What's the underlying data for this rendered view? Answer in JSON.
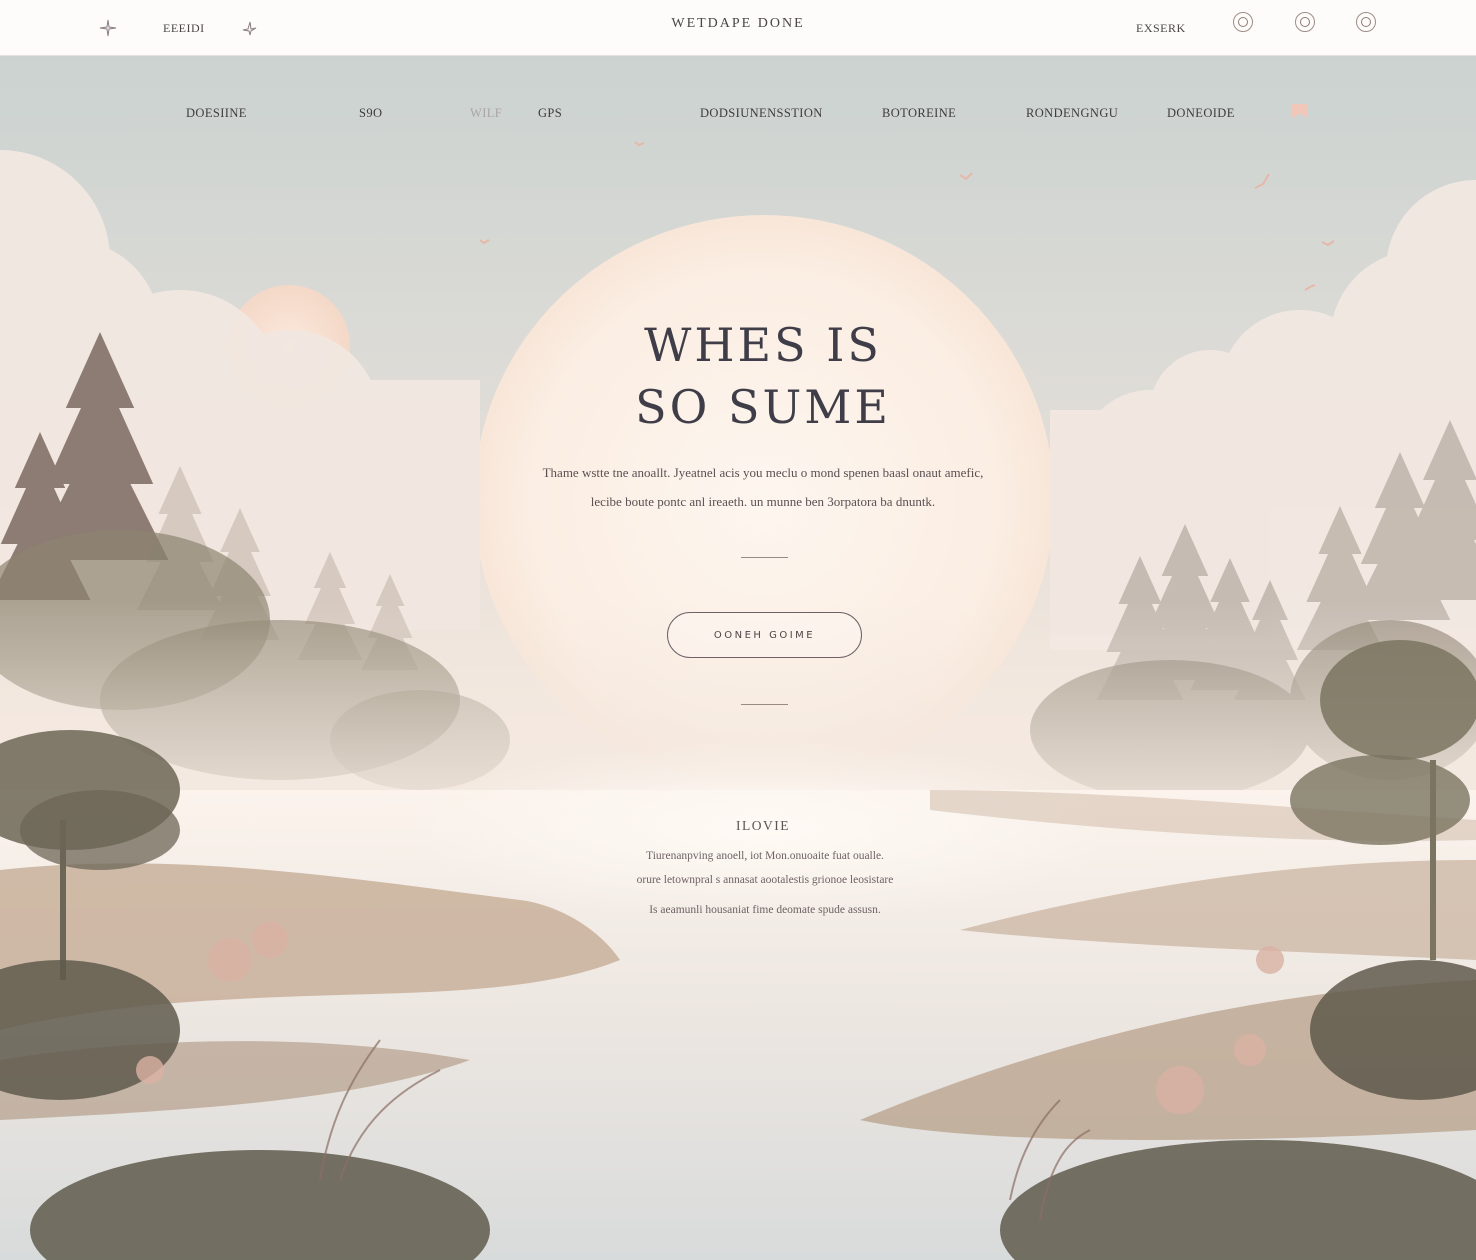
{
  "topbar": {
    "left_link": "EEEIDI",
    "brand": "WETDAPE DONE",
    "right_link": "EXSERK",
    "icons": [
      "sparkle-icon",
      "star-icon",
      "social-icon-1",
      "social-icon-2",
      "social-icon-3"
    ]
  },
  "nav": {
    "items": [
      {
        "label": "DOESIINE"
      },
      {
        "label": "S9O"
      },
      {
        "label": "WILF"
      },
      {
        "label": "GPS"
      },
      {
        "label": "DODSIUNENSSTION"
      },
      {
        "label": "BOTOREINE"
      },
      {
        "label": "RONDENGNGU"
      },
      {
        "label": "DONEOIDE"
      }
    ],
    "bookmark_icon": "bookmark-icon"
  },
  "hero": {
    "title_line1": "WHES IS",
    "title_line2": "SO SUME",
    "desc_line1": "Thame wstte tne anoallt. Jyeatnel acis you meclu o mond spenen baasl onaut amefic,",
    "desc_line2": "lecibe boute pontc anl ireaeth. un munne ben 3orpatora ba dnuntk.",
    "cta_label": "OONEH GOIME"
  },
  "section": {
    "title": "ILOVIE",
    "line1": "Tiurenanpving anoell, iot Mon.onuoaite fuat oualle.",
    "line2": "orure letownpral s annasat aootalestis grionoe leosistare",
    "line3": "Is aeamunli housaniat fime deomate spude assusn."
  },
  "colors": {
    "sky": "#c9d2d0",
    "sun": "#fbefe5",
    "accent": "#f1c7ba",
    "text": "#3f3d48"
  }
}
